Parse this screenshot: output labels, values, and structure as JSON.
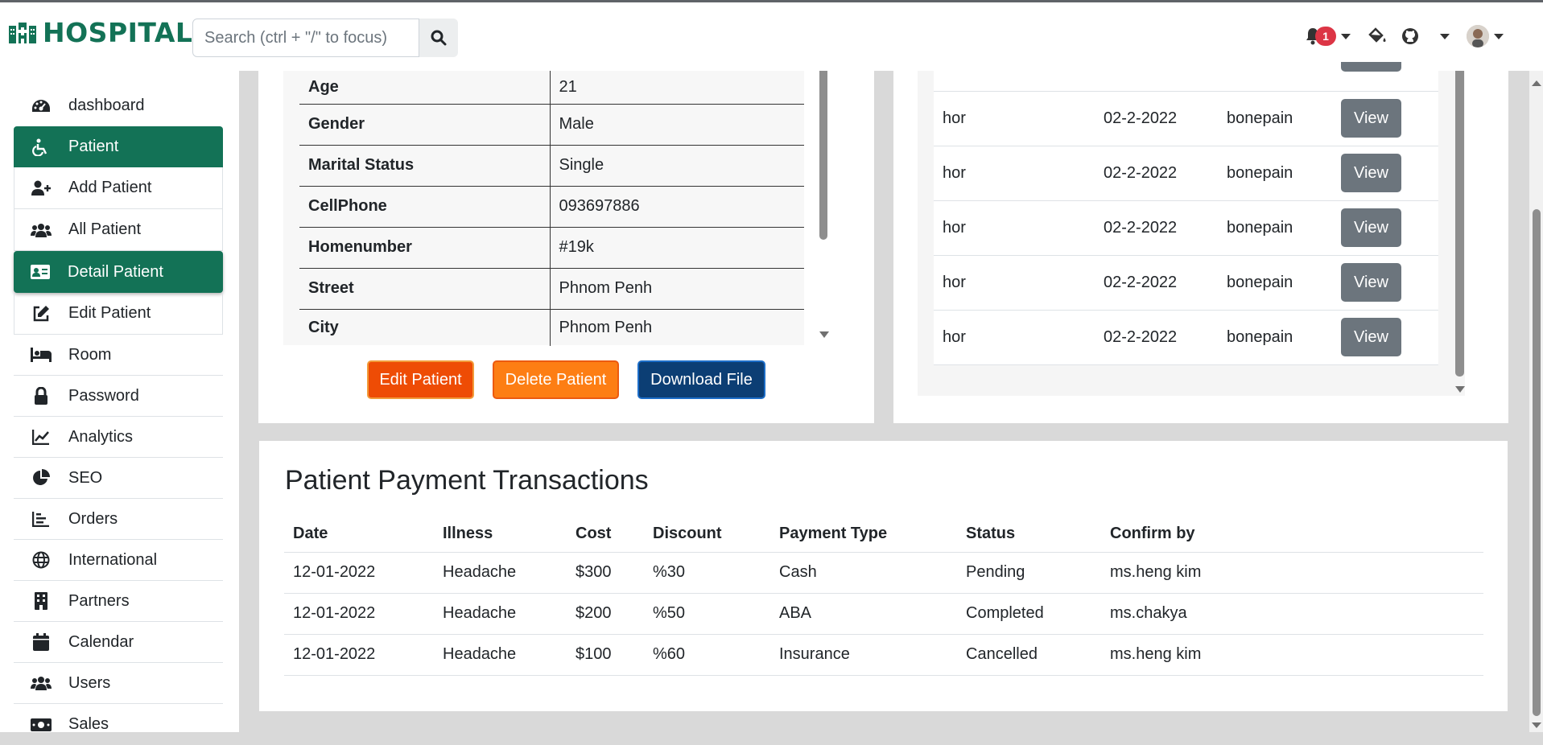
{
  "brand": {
    "name": "HOSPITAL"
  },
  "search": {
    "placeholder": "Search (ctrl + \"/\" to focus)"
  },
  "notifications": {
    "count": "1"
  },
  "sidebar": {
    "items": [
      {
        "label": "dashboard",
        "icon": "dashboard-icon"
      },
      {
        "label": "Patient",
        "icon": "wheelchair-icon"
      },
      {
        "label": "Add Patient",
        "icon": "user-plus-icon"
      },
      {
        "label": "All Patient",
        "icon": "users-icon"
      },
      {
        "label": "Detail Patient",
        "icon": "id-card-icon"
      },
      {
        "label": "Edit Patient",
        "icon": "edit-icon"
      },
      {
        "label": "Room",
        "icon": "bed-icon"
      },
      {
        "label": "Password",
        "icon": "lock-icon"
      },
      {
        "label": "Analytics",
        "icon": "chart-line-icon"
      },
      {
        "label": "SEO",
        "icon": "pie-chart-icon"
      },
      {
        "label": "Orders",
        "icon": "list-icon"
      },
      {
        "label": "International",
        "icon": "globe-icon"
      },
      {
        "label": "Partners",
        "icon": "building-icon"
      },
      {
        "label": "Calendar",
        "icon": "calendar-icon"
      },
      {
        "label": "Users",
        "icon": "users-icon"
      },
      {
        "label": "Sales",
        "icon": "money-icon"
      }
    ]
  },
  "patient_detail": {
    "rows": [
      {
        "key": "Age",
        "value": "21"
      },
      {
        "key": "Gender",
        "value": "Male"
      },
      {
        "key": "Marital Status",
        "value": "Single"
      },
      {
        "key": "CellPhone",
        "value": "093697886"
      },
      {
        "key": "Homenumber",
        "value": "#19k"
      },
      {
        "key": "Street",
        "value": "Phnom Penh"
      },
      {
        "key": "City",
        "value": "Phnom Penh"
      }
    ],
    "buttons": {
      "edit": "Edit Patient",
      "delete": "Delete Patient",
      "download": "Download File"
    }
  },
  "visits": {
    "view_label": "View",
    "rows": [
      {
        "name": "hor",
        "date": "02-2-2022",
        "illness": "bonepain"
      },
      {
        "name": "hor",
        "date": "02-2-2022",
        "illness": "bonepain"
      },
      {
        "name": "hor",
        "date": "02-2-2022",
        "illness": "bonepain"
      },
      {
        "name": "hor",
        "date": "02-2-2022",
        "illness": "bonepain"
      },
      {
        "name": "hor",
        "date": "02-2-2022",
        "illness": "bonepain"
      }
    ]
  },
  "payments": {
    "title": "Patient Payment Transactions",
    "headers": [
      "Date",
      "Illness",
      "Cost",
      "Discount",
      "Payment Type",
      "Status",
      "Confirm by"
    ],
    "rows": [
      [
        "12-01-2022",
        "Headache",
        "$300",
        "%30",
        "Cash",
        "Pending",
        "ms.heng kim"
      ],
      [
        "12-01-2022",
        "Headache",
        "$200",
        "%50",
        "ABA",
        "Completed",
        "ms.chakya"
      ],
      [
        "12-01-2022",
        "Headache",
        "$100",
        "%60",
        "Insurance",
        "Cancelled",
        "ms.heng kim"
      ]
    ]
  },
  "colors": {
    "brand": "#137256",
    "edit": "#ee4c05",
    "delete": "#fd7e14",
    "download": "#0c3e74",
    "view": "#6c757d",
    "badge": "#dc3545"
  }
}
